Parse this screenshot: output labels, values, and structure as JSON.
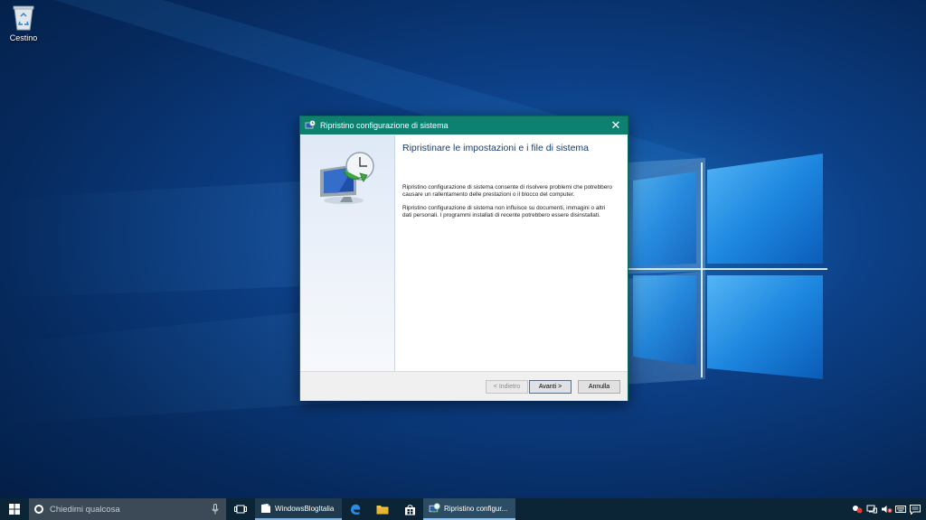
{
  "desktop": {
    "recycle_bin_label": "Cestino"
  },
  "dialog": {
    "title": "Ripristino configurazione di sistema",
    "heading": "Ripristinare le impostazioni e i file di sistema",
    "paragraph1": "Ripristino configurazione di sistema consente di risolvere problemi che potrebbero causare un rallentamento delle prestazioni o il blocco del computer.",
    "paragraph2": "Ripristino configurazione di sistema non influisce su documenti, immagini o altri dati personali. I programmi installati di recente potrebbero essere disinstallati.",
    "buttons": {
      "back": "< Indietro",
      "next": "Avanti >",
      "cancel": "Annulla"
    },
    "close_glyph": "✕"
  },
  "taskbar": {
    "search_placeholder": "Chiedimi qualcosa",
    "tasks": [
      {
        "label": "WindowsBlogItalia",
        "icon": "document-app-icon"
      },
      {
        "label": "Ripristino configur...",
        "icon": "system-restore-icon"
      }
    ],
    "pinned": [
      "task-view-icon",
      "edge-icon",
      "file-explorer-icon",
      "store-icon"
    ],
    "tray": [
      "people-alert-icon",
      "network-icon",
      "volume-muted-icon",
      "keyboard-icon",
      "action-center-icon"
    ]
  },
  "colors": {
    "dialog_titlebar": "#0d8070",
    "taskbar": "#0b2537",
    "desktop_accent": "#1a6fc0"
  }
}
